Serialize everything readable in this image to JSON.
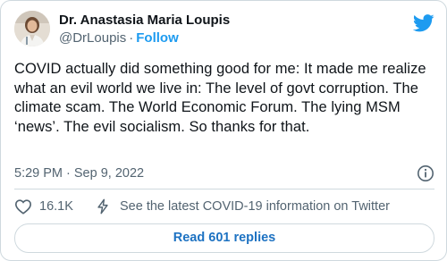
{
  "author": {
    "display_name": "Dr. Anastasia Maria Loupis",
    "handle": "@DrLoupis",
    "separator": "·",
    "follow_label": "Follow"
  },
  "tweet": {
    "text": "COVID actually did something good for me: It made me realize what an evil world we live in: The level of govt corruption. The climate scam. The World Economic Forum. The lying MSM ‘news’. The evil socialism. So thanks for that.",
    "time": "5:29 PM",
    "date": "Sep 9, 2022"
  },
  "actions": {
    "like_count": "16.1K",
    "covid_info": "See the latest COVID-19 information on Twitter"
  },
  "replies": {
    "label": "Read 601 replies"
  },
  "icons": {
    "brand": "twitter-bird-icon",
    "info": "info-icon",
    "like": "heart-icon",
    "covid": "lightning-icon"
  },
  "colors": {
    "brand_blue": "#1d9bf0",
    "reply_link": "#1d72c2",
    "secondary_text": "#536471",
    "border": "#cfd9de",
    "text": "#0f1419"
  }
}
